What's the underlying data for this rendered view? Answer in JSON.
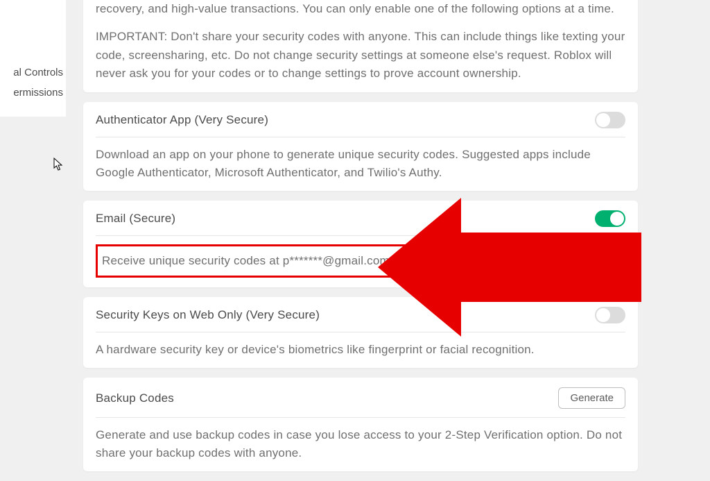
{
  "sidebar": {
    "items": [
      {
        "label": "al Controls"
      },
      {
        "label": "ermissions"
      }
    ]
  },
  "intro": {
    "p1": "recovery, and high-value transactions. You can only enable one of the following options at a time.",
    "p2": "IMPORTANT: Don't share your security codes with anyone. This can include things like texting your code, screensharing, etc. Do not change security settings at someone else's request. Roblox will never ask you for your codes or to change settings to prove account ownership."
  },
  "authenticator": {
    "title": "Authenticator App (Very Secure)",
    "desc": "Download an app on your phone to generate unique security codes. Suggested apps include Google Authenticator, Microsoft Authenticator, and Twilio's Authy."
  },
  "email": {
    "title": "Email (Secure)",
    "desc": "Receive unique security codes at p*******@gmail.com."
  },
  "security_keys": {
    "title": "Security Keys on Web Only (Very Secure)",
    "desc": "A hardware security key or device's biometrics like fingerprint or facial recognition."
  },
  "backup": {
    "title": "Backup Codes",
    "button": "Generate",
    "desc": "Generate and use backup codes in case you lose access to your 2-Step Verification option. Do not share your backup codes with anyone."
  }
}
